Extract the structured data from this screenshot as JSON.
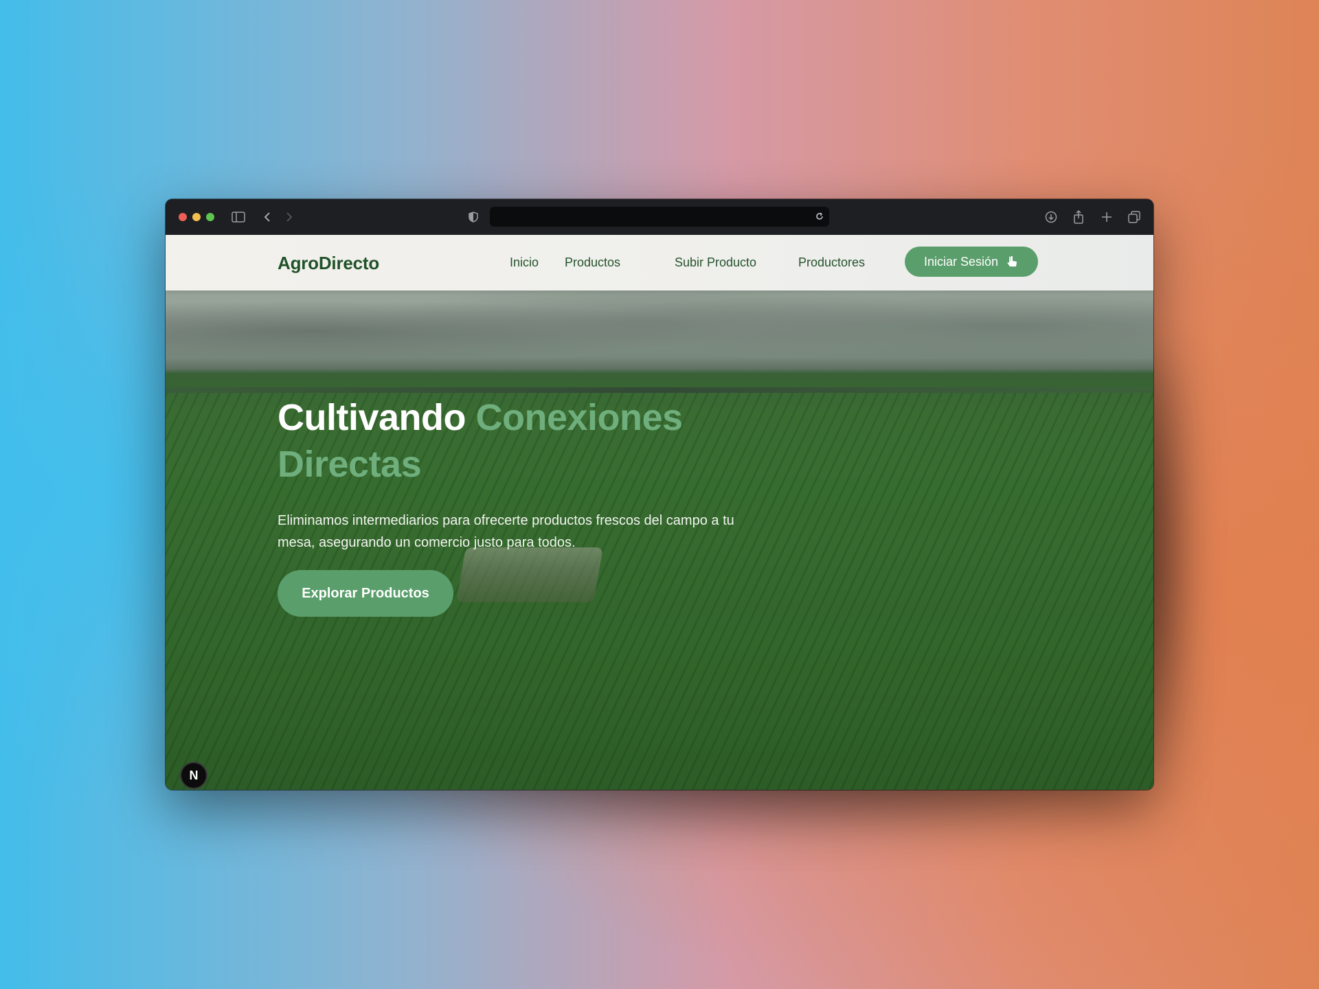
{
  "browser": {
    "toolbar_icons": [
      "sidebar-icon",
      "back-icon",
      "forward-icon",
      "shield-icon",
      "reload-icon",
      "download-icon",
      "share-icon",
      "new-tab-icon",
      "tabs-overview-icon"
    ],
    "url": ""
  },
  "navbar": {
    "logo": "AgroDirecto",
    "links": [
      "Inicio",
      "Productos",
      "Subir Producto",
      "Productores"
    ],
    "login_label": "Iniciar Sesión",
    "login_icon": "cursor-hand-icon"
  },
  "hero": {
    "title_plain": "Cultivando",
    "title_accent": "Conexiones Directas",
    "subtitle": "Eliminamos intermediarios para ofrecerte productos frescos del campo a tu mesa, asegurando un comercio justo para todos.",
    "cta_label": "Explorar Productos"
  },
  "dev_badge": "N",
  "colors": {
    "brand_dark": "#20522a",
    "accent_green": "#5a9e6b",
    "title_accent": "#6fae7d"
  }
}
